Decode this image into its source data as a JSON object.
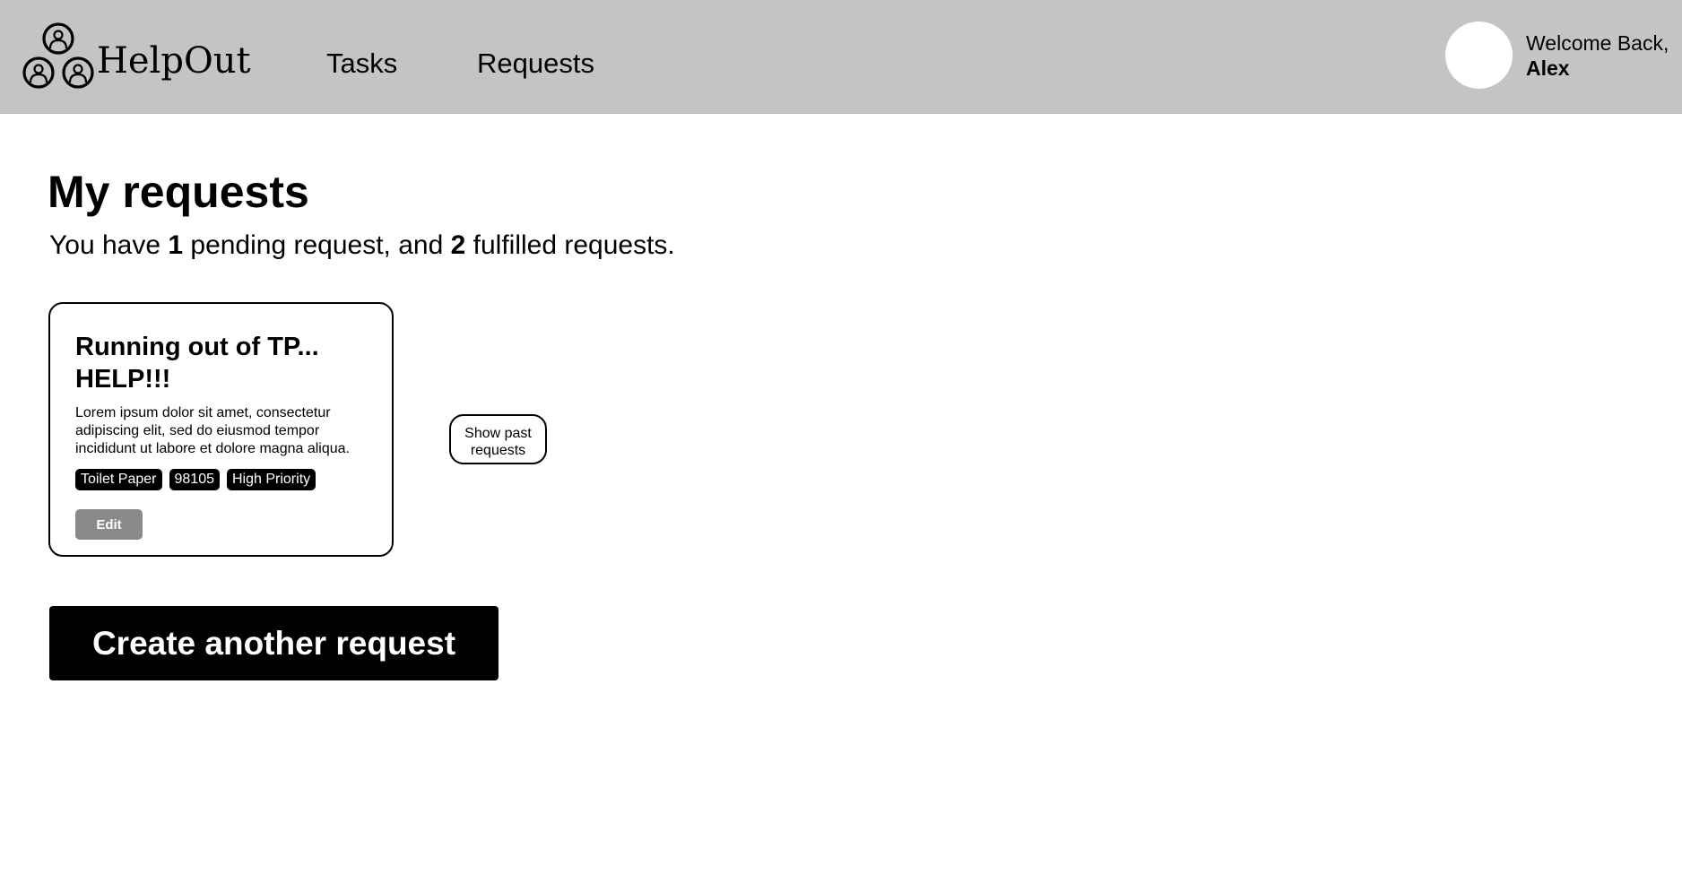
{
  "header": {
    "brand": "HelpOut",
    "logo_icon": "helpers-group-icon",
    "nav": {
      "tasks": "Tasks",
      "requests": "Requests"
    },
    "welcome_text": "Welcome Back,",
    "user_name": "Alex"
  },
  "main": {
    "title": "My requests",
    "summary": {
      "prefix": "You have ",
      "pending_count": "1",
      "middle": " pending request, and ",
      "fulfilled_count": "2",
      "suffix": " fulfilled requests."
    },
    "request_card": {
      "title": "Running out of TP... HELP!!!",
      "description": "Lorem ipsum dolor sit amet, consectetur adipiscing elit, sed do eiusmod tempor incididunt ut labore et dolore magna aliqua.",
      "tags": [
        "Toilet Paper",
        "98105",
        "High Priority"
      ],
      "edit_label": "Edit"
    },
    "show_past_label": "Show past requests",
    "create_label": "Create another request"
  },
  "colors": {
    "header_bg": "#c4c4c4",
    "primary": "#000000",
    "muted_button": "#8a8a8a"
  }
}
